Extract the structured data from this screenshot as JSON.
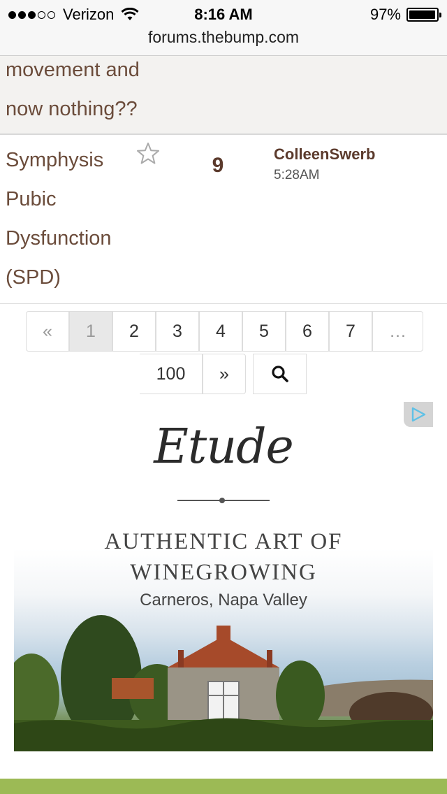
{
  "status_bar": {
    "carrier": "Verizon",
    "signal_bars_filled": 3,
    "signal_bars_total": 5,
    "time": "8:16 AM",
    "battery_percent": "97%",
    "battery_level": 0.97
  },
  "url_bar": {
    "domain": "forums.thebump.com"
  },
  "topics": [
    {
      "title_lines": [
        "movement and",
        "now nothing??"
      ]
    },
    {
      "title_lines": [
        "Symphysis",
        "Pubic",
        "Dysfunction",
        "(SPD)"
      ],
      "replies": "9",
      "last_poster": "ColleenSwerb",
      "last_time": "5:28AM"
    }
  ],
  "pagination": {
    "prev": "«",
    "pages": [
      "1",
      "2",
      "3",
      "4",
      "5",
      "6",
      "7"
    ],
    "current": "1",
    "ellipsis": "…",
    "last": "100",
    "next": "»",
    "search_icon": "search-icon"
  },
  "ad": {
    "brand": "Etude",
    "headline_lines": [
      "AUTHENTIC ART OF",
      "WINEGROWING"
    ],
    "subtitle": "Carneros, Napa Valley",
    "adchoices_icon": "adchoices-icon"
  },
  "colors": {
    "title": "#6b4c3b",
    "author": "#5b3a2c",
    "bottom_bar": "#9cba55"
  }
}
